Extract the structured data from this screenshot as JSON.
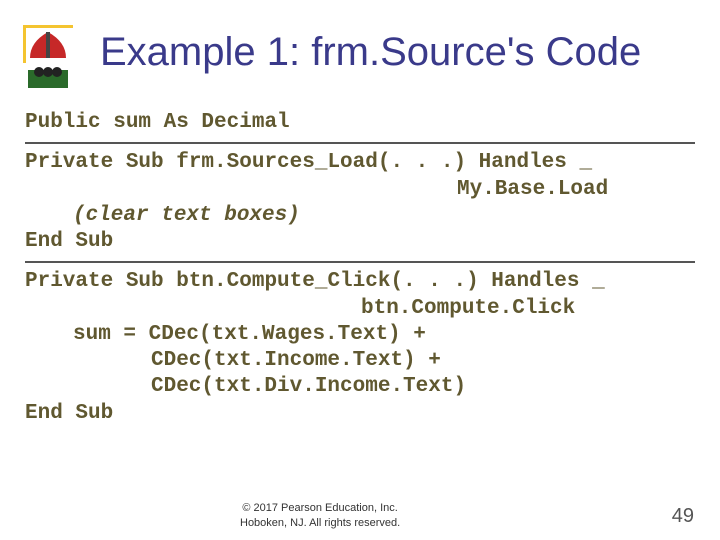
{
  "title": "Example 1: frm.Source's Code",
  "code": {
    "l1": "Public sum As Decimal",
    "l2": "Private Sub frm.Sources_Load(. . .) Handles _",
    "l3": "My.Base.Load",
    "l4": "(clear text boxes)",
    "l5": "End Sub",
    "l6": "Private Sub btn.Compute_Click(. . .) Handles _",
    "l7": "btn.Compute.Click",
    "l8": "sum = CDec(txt.Wages.Text) +",
    "l9": "CDec(txt.Income.Text) +",
    "l10": "CDec(txt.Div.Income.Text)",
    "l11": "End Sub"
  },
  "footer": {
    "line1": "© 2017 Pearson Education, Inc.",
    "line2": "Hoboken, NJ. All rights reserved."
  },
  "page": "49"
}
